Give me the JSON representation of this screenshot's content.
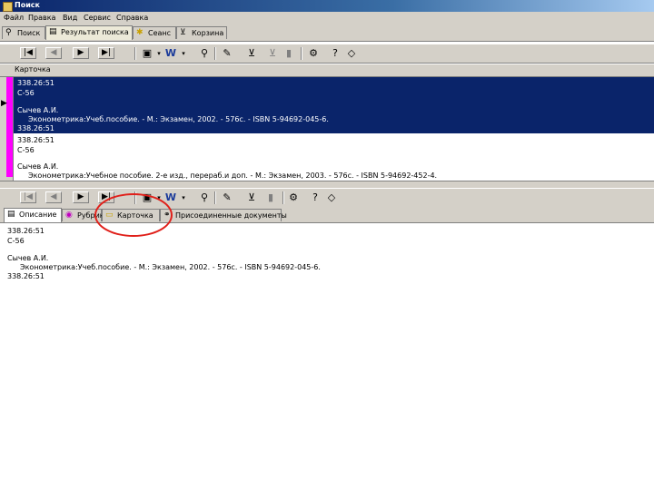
{
  "window": {
    "title": "Поиск"
  },
  "menu": [
    "Файл",
    "Правка",
    "Вид",
    "Сервис",
    "Справка"
  ],
  "tabs": [
    {
      "label": "Поиск"
    },
    {
      "label": "Результат поиска"
    },
    {
      "label": "Сеанс"
    },
    {
      "label": "Корзина"
    }
  ],
  "grid": {
    "column_header": "Карточка"
  },
  "records": {
    "selected": [
      "338.26:51",
      "С-56",
      "",
      "Сычев А.И.",
      "Эконометрика:Учеб.пособие. - М.: Экзамен, 2002. - 576с. - ISBN 5-94692-045-6.",
      "338.26:51"
    ],
    "second": [
      "338.26:51",
      "С-56",
      "",
      "Сычев А.И.",
      "Эконометрика:Учебное пособие. 2-е изд., перераб.и доп. - М.: Экзамен, 2003. - 576с. - ISBN 5-94692-452-4."
    ]
  },
  "bottom_tabs": [
    {
      "label": "Описание"
    },
    {
      "label": "Рубрики"
    },
    {
      "label": "Карточка"
    },
    {
      "label": "Присоединенные документы"
    }
  ],
  "description": {
    "lines": [
      "338.26:51",
      "С-56",
      "",
      "Сычев А.И.",
      "Эконометрика:Учеб.пособие. - М.: Экзамен, 2002. - 576с. - ISBN 5-94692-045-6.",
      "338.26:51"
    ]
  },
  "colors": {
    "selection": "#0a246a",
    "marker": "#ff00ff",
    "highlight_circle": "#e0201a"
  }
}
